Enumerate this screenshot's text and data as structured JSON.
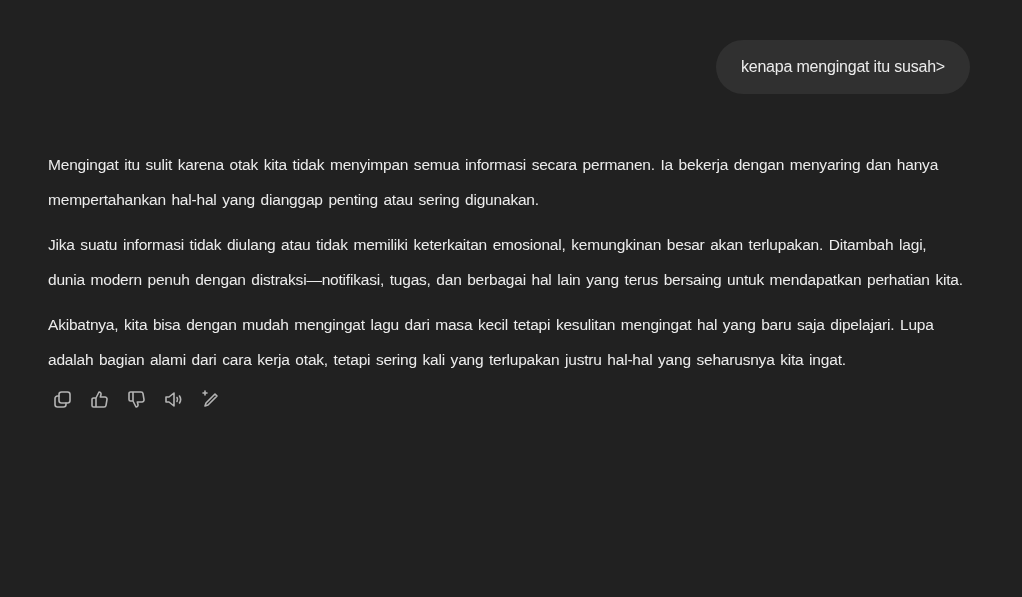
{
  "user_message": "kenapa mengingat itu susah>",
  "reply_paragraphs": [
    "Mengingat itu sulit karena otak kita tidak menyimpan semua informasi secara permanen. Ia bekerja dengan menyaring dan hanya mempertahankan hal-hal yang dianggap penting atau sering digunakan.",
    "Jika suatu informasi tidak diulang atau tidak memiliki keterkaitan emosional, kemungkinan besar akan terlupakan. Ditambah lagi, dunia modern penuh dengan distraksi—notifikasi, tugas, dan berbagai hal lain yang terus bersaing untuk mendapatkan perhatian kita.",
    "Akibatnya, kita bisa dengan mudah mengingat lagu dari masa kecil tetapi kesulitan mengingat hal yang baru saja dipelajari. Lupa adalah bagian alami dari cara kerja otak, tetapi sering kali yang terlupakan justru hal-hal yang seharusnya kita ingat."
  ]
}
